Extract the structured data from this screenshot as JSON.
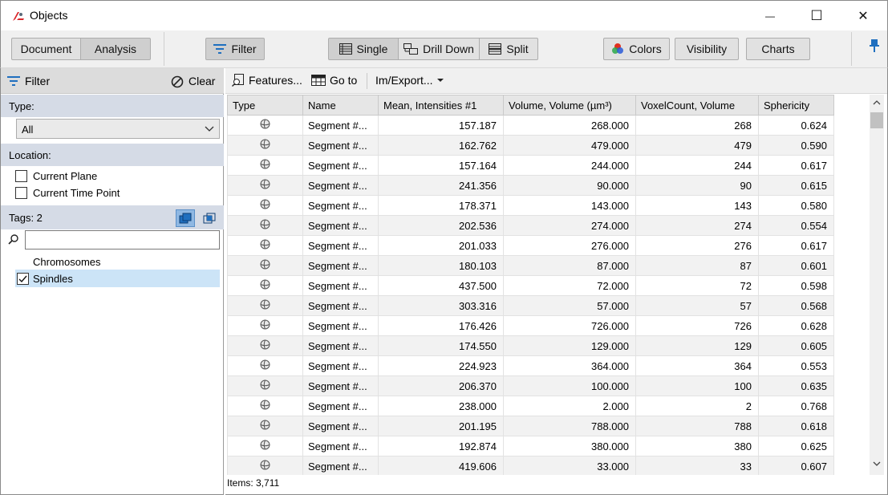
{
  "window": {
    "title": "Objects",
    "min_glyph": "—",
    "max_glyph": "☐",
    "close_glyph": "✕"
  },
  "toolbar": {
    "document_label": "Document",
    "analysis_label": "Analysis",
    "filter_label": "Filter",
    "single_label": "Single",
    "drilldown_label": "Drill Down",
    "split_label": "Split",
    "colors_label": "Colors",
    "visibility_label": "Visibility",
    "charts_label": "Charts"
  },
  "filter_panel": {
    "title": "Filter",
    "clear_label": "Clear",
    "type_label": "Type:",
    "type_value": "All",
    "location_label": "Location:",
    "current_plane_label": "Current Plane",
    "current_plane_checked": false,
    "current_time_label": "Current Time Point",
    "current_time_checked": false,
    "tags_label": "Tags: 2",
    "search_value": "",
    "tags": [
      {
        "label": "Chromosomes",
        "checked": null,
        "selected": false
      },
      {
        "label": "Spindles",
        "checked": true,
        "selected": true
      }
    ]
  },
  "table_toolbar": {
    "features_label": "Features...",
    "goto_label": "Go to",
    "imexport_label": "Im/Export..."
  },
  "table": {
    "columns": [
      "Type",
      "Name",
      "Mean, Intensities #1",
      "Volume, Volume (µm³)",
      "VoxelCount, Volume",
      "Sphericity"
    ],
    "rows": [
      [
        "Segment #...",
        "157.187",
        "268.000",
        "268",
        "0.624"
      ],
      [
        "Segment #...",
        "162.762",
        "479.000",
        "479",
        "0.590"
      ],
      [
        "Segment #...",
        "157.164",
        "244.000",
        "244",
        "0.617"
      ],
      [
        "Segment #...",
        "241.356",
        "90.000",
        "90",
        "0.615"
      ],
      [
        "Segment #...",
        "178.371",
        "143.000",
        "143",
        "0.580"
      ],
      [
        "Segment #...",
        "202.536",
        "274.000",
        "274",
        "0.554"
      ],
      [
        "Segment #...",
        "201.033",
        "276.000",
        "276",
        "0.617"
      ],
      [
        "Segment #...",
        "180.103",
        "87.000",
        "87",
        "0.601"
      ],
      [
        "Segment #...",
        "437.500",
        "72.000",
        "72",
        "0.598"
      ],
      [
        "Segment #...",
        "303.316",
        "57.000",
        "57",
        "0.568"
      ],
      [
        "Segment #...",
        "176.426",
        "726.000",
        "726",
        "0.628"
      ],
      [
        "Segment #...",
        "174.550",
        "129.000",
        "129",
        "0.605"
      ],
      [
        "Segment #...",
        "224.923",
        "364.000",
        "364",
        "0.553"
      ],
      [
        "Segment #...",
        "206.370",
        "100.000",
        "100",
        "0.635"
      ],
      [
        "Segment #...",
        "238.000",
        "2.000",
        "2",
        "0.768"
      ],
      [
        "Segment #...",
        "201.195",
        "788.000",
        "788",
        "0.618"
      ],
      [
        "Segment #...",
        "192.874",
        "380.000",
        "380",
        "0.625"
      ],
      [
        "Segment #...",
        "419.606",
        "33.000",
        "33",
        "0.607"
      ]
    ]
  },
  "status": {
    "items_label": "Items: 3,711"
  },
  "colors": {
    "accent_blue": "#1f6fbf",
    "selected_row": "#cce4f7",
    "section_bg": "#d5dbe6",
    "logo_red": "#d9262b"
  }
}
